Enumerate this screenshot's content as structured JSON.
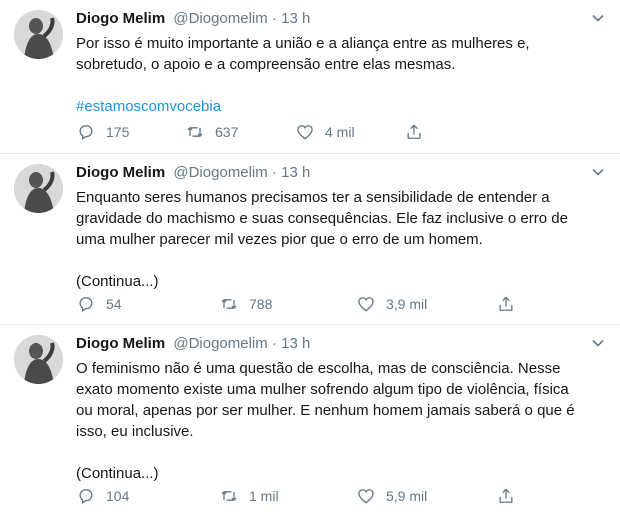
{
  "tweets": [
    {
      "name": "Diogo Melim",
      "handle": "@Diogomelim",
      "dot": "·",
      "time": "13 h",
      "lines": [
        "Por isso é muito importante a união e a aliança entre as mulheres e,",
        "sobretudo, o apoio e a compreensão entre elas mesmas."
      ],
      "hashtag": "#estamoscomvocebia",
      "replies": "175",
      "retweets": "637",
      "likes": "4 mil"
    },
    {
      "name": "Diogo Melim",
      "handle": "@Diogomelim",
      "dot": "·",
      "time": "13 h",
      "lines": [
        "Enquanto seres humanos precisamos ter a sensibilidade de entender a",
        "gravidade do machismo e suas consequências. Ele faz inclusive o erro de",
        "uma mulher parecer mil vezes pior que o erro de um homem."
      ],
      "continua": "(Continua...)",
      "replies": "54",
      "retweets": "788",
      "likes": "3,9 mil"
    },
    {
      "name": "Diogo Melim",
      "handle": "@Diogomelim",
      "dot": "·",
      "time": "13 h",
      "lines": [
        "O feminismo não é uma questão de escolha, mas de consciência. Nesse",
        "exato momento existe uma mulher sofrendo algum tipo de violência, física",
        "ou moral, apenas por ser mulher. E nenhum homem jamais saberá o que é",
        "isso, eu inclusive."
      ],
      "continua": "(Continua...)",
      "replies": "104",
      "retweets": "1 mil",
      "likes": "5,9 mil"
    }
  ],
  "colors": {
    "text": "#14171a",
    "secondary": "#657786",
    "link": "#1b95e0",
    "divider": "#e6ecf0"
  },
  "icons": [
    "chevron-down-icon",
    "reply-icon",
    "retweet-icon",
    "like-icon",
    "share-icon",
    "avatar"
  ]
}
